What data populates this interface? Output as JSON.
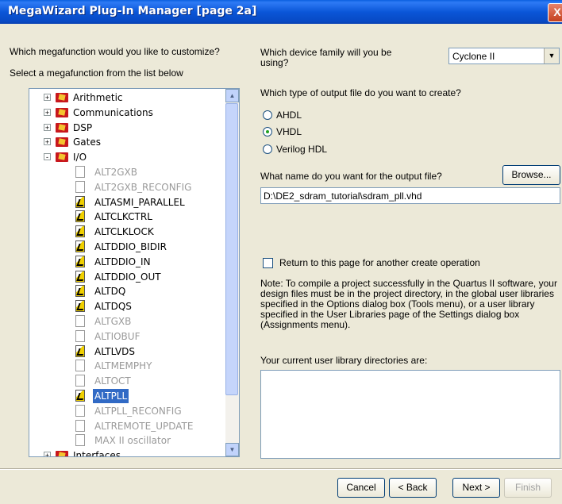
{
  "window": {
    "title": "MegaWizard Plug-In Manager [page 2a]",
    "close_glyph": "X"
  },
  "left": {
    "question": "Which megafunction would you like to customize?",
    "instruction": "Select a megafunction from the list below"
  },
  "tree": {
    "rows": [
      {
        "label": "Arithmetic",
        "type": "folder",
        "expander": "+",
        "state": "normal"
      },
      {
        "label": "Communications",
        "type": "folder",
        "expander": "+",
        "state": "normal"
      },
      {
        "label": "DSP",
        "type": "folder",
        "expander": "+",
        "state": "normal"
      },
      {
        "label": "Gates",
        "type": "folder",
        "expander": "+",
        "state": "normal"
      },
      {
        "label": "I/O",
        "type": "folder",
        "expander": "-",
        "state": "normal"
      },
      {
        "label": "ALT2GXB",
        "type": "item",
        "state": "disabled"
      },
      {
        "label": "ALT2GXB_RECONFIG",
        "type": "item",
        "state": "disabled"
      },
      {
        "label": "ALTASMI_PARALLEL",
        "type": "item",
        "state": "normal"
      },
      {
        "label": "ALTCLKCTRL",
        "type": "item",
        "state": "normal"
      },
      {
        "label": "ALTCLKLOCK",
        "type": "item",
        "state": "normal"
      },
      {
        "label": "ALTDDIO_BIDIR",
        "type": "item",
        "state": "normal"
      },
      {
        "label": "ALTDDIO_IN",
        "type": "item",
        "state": "normal"
      },
      {
        "label": "ALTDDIO_OUT",
        "type": "item",
        "state": "normal"
      },
      {
        "label": "ALTDQ",
        "type": "item",
        "state": "normal"
      },
      {
        "label": "ALTDQS",
        "type": "item",
        "state": "normal"
      },
      {
        "label": "ALTGXB",
        "type": "item",
        "state": "disabled"
      },
      {
        "label": "ALTIOBUF",
        "type": "item",
        "state": "disabled"
      },
      {
        "label": "ALTLVDS",
        "type": "item",
        "state": "normal"
      },
      {
        "label": "ALTMEMPHY",
        "type": "item",
        "state": "disabled"
      },
      {
        "label": "ALTOCT",
        "type": "item",
        "state": "disabled"
      },
      {
        "label": "ALTPLL",
        "type": "item",
        "state": "selected"
      },
      {
        "label": "ALTPLL_RECONFIG",
        "type": "item",
        "state": "disabled"
      },
      {
        "label": "ALTREMOTE_UPDATE",
        "type": "item",
        "state": "disabled"
      },
      {
        "label": "MAX II oscillator",
        "type": "item",
        "state": "disabled"
      },
      {
        "label": "Interfaces",
        "type": "folder",
        "expander": "+",
        "state": "normal"
      }
    ]
  },
  "device": {
    "question": "Which device family will you be using?",
    "selected": "Cyclone II"
  },
  "output_type": {
    "question": "Which type of output file do you want to create?",
    "options": [
      {
        "label": "AHDL",
        "checked": false
      },
      {
        "label": "VHDL",
        "checked": true
      },
      {
        "label": "Verilog HDL",
        "checked": false
      }
    ]
  },
  "output_name": {
    "question": "What name do you want for the output file?",
    "browse_label": "Browse...",
    "value": "D:\\DE2_sdram_tutorial\\sdram_pll.vhd"
  },
  "return_checkbox": {
    "label": "Return to this page for another create operation",
    "checked": false
  },
  "note": "Note: To compile a project successfully in the Quartus II software, your design files must be in the project directory, in the global user libraries specified in the Options dialog box (Tools menu), or a user library specified in the User Libraries page of the Settings dialog box (Assignments menu).",
  "user_libs": {
    "label": "Your current user library directories are:"
  },
  "buttons": {
    "cancel": "Cancel",
    "back": "< Back",
    "next": "Next >",
    "finish": "Finish"
  }
}
